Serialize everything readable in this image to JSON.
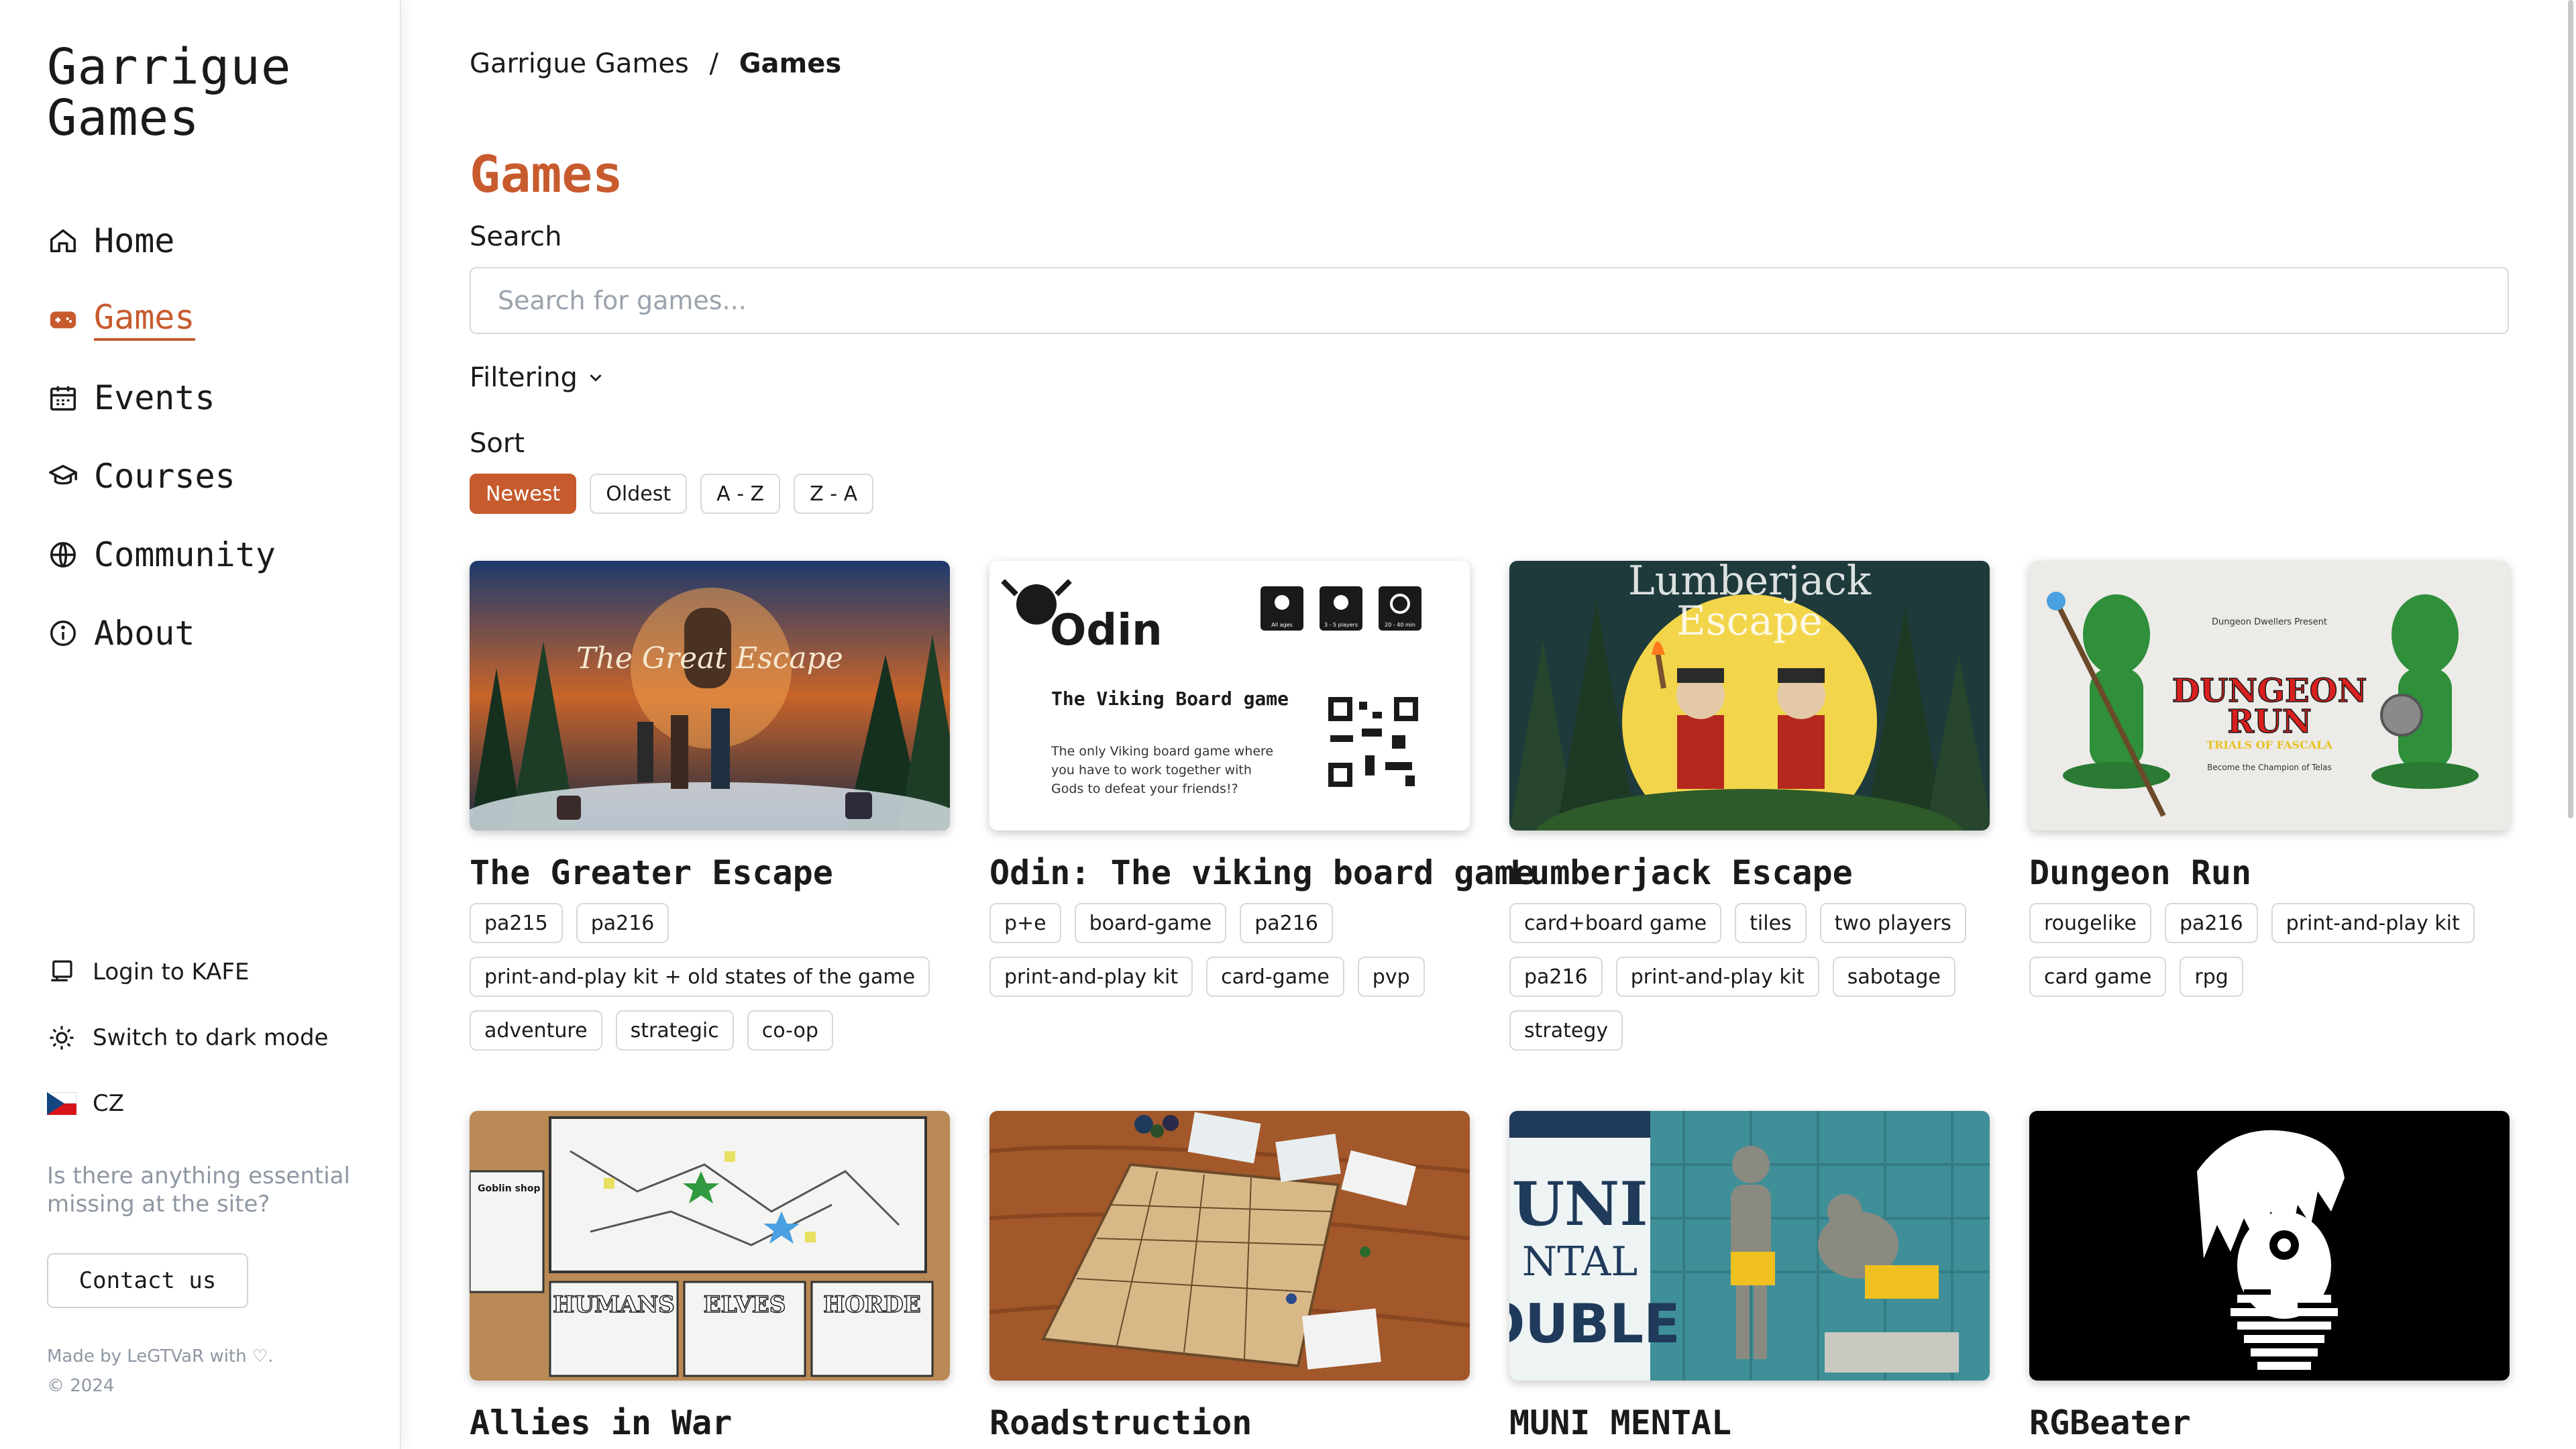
{
  "sidebar": {
    "brand": "Garrigue Games",
    "nav": [
      {
        "label": "Home",
        "icon": "home-icon"
      },
      {
        "label": "Games",
        "icon": "gamepad-icon",
        "active": true
      },
      {
        "label": "Events",
        "icon": "calendar-icon"
      },
      {
        "label": "Courses",
        "icon": "graduation-cap-icon"
      },
      {
        "label": "Community",
        "icon": "globe-icon"
      },
      {
        "label": "About",
        "icon": "info-icon"
      }
    ],
    "login_label": "Login to KAFE",
    "dark_mode_label": "Switch to dark mode",
    "language_label": "CZ",
    "missing_text": "Is there anything essential missing at the site?",
    "contact_label": "Contact us",
    "made_by": "Made by LeGTVaR with ♡.",
    "copyright": "© 2024"
  },
  "breadcrumb": {
    "root": "Garrigue Games",
    "separator": "/",
    "current": "Games"
  },
  "page_title": "Games",
  "search": {
    "label": "Search",
    "placeholder": "Search for games..."
  },
  "filtering_label": "Filtering",
  "sort": {
    "label": "Sort",
    "options": [
      "Newest",
      "Oldest",
      "A - Z",
      "Z - A"
    ],
    "active": "Newest"
  },
  "games": [
    {
      "title": "The Greater Escape",
      "tags": [
        "pa215",
        "pa216",
        "print-and-play kit + old states of the game",
        "adventure",
        "strategic",
        "co-op"
      ]
    },
    {
      "title": "Odin: The viking board game",
      "tags": [
        "p+e",
        "board-game",
        "pa216",
        "print-and-play kit",
        "card-game",
        "pvp"
      ]
    },
    {
      "title": "Lumberjack Escape",
      "tags": [
        "card+board game",
        "tiles",
        "two players",
        "pa216",
        "print-and-play kit",
        "sabotage",
        "strategy"
      ]
    },
    {
      "title": "Dungeon Run",
      "tags": [
        "rougelike",
        "pa216",
        "print-and-play kit",
        "card game",
        "rpg"
      ]
    },
    {
      "title": "Allies in War",
      "tags": []
    },
    {
      "title": "Roadstruction",
      "tags": []
    },
    {
      "title": "MUNI MENTAL",
      "tags": []
    },
    {
      "title": "RGBeater",
      "tags": []
    }
  ],
  "thumb_text": {
    "escape_title": "The Great Escape",
    "odin_name": "Odin",
    "odin_subtitle": "The Viking Board game",
    "odin_blurb_1": "The only Viking board game where",
    "odin_blurb_2": "you have to work together with",
    "odin_blurb_3": "Gods to defeat your friends!?",
    "odin_badge_1": "All ages",
    "odin_badge_2": "3 - 5 players",
    "odin_badge_3": "20 - 40 min",
    "lumber_title_1": "Lumberjack",
    "lumber_title_2": "Escape",
    "dungeon_presents": "Dungeon Dwellers Present",
    "dungeon_title_1": "DUNGEON",
    "dungeon_title_2": "RUN",
    "dungeon_sub": "TRIALS OF FASCALA",
    "dungeon_tagline": "Become the Champion of Telas",
    "allies_1": "Goblin shop",
    "allies_2": "HUMANS",
    "allies_3": "ELVES",
    "allies_4": "HORDE",
    "muni_1": "UNI",
    "muni_2": "NTAL",
    "muni_3": "OUBLE"
  },
  "colors": {
    "accent": "#c75b2e",
    "border": "#d5d9de",
    "muted": "#8e97a3"
  }
}
